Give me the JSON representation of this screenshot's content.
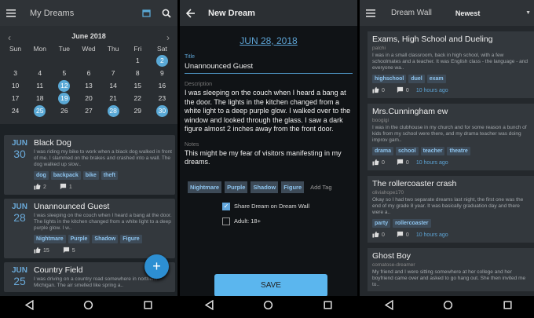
{
  "p1": {
    "title": "My Dreams",
    "month": "June 2018",
    "weekdays": [
      "Sun",
      "Mon",
      "Tue",
      "Wed",
      "Thu",
      "Fri",
      "Sat"
    ],
    "weeks": [
      [
        "",
        "",
        "",
        "",
        "",
        "1",
        "2"
      ],
      [
        "3",
        "4",
        "5",
        "6",
        "7",
        "8",
        "9"
      ],
      [
        "10",
        "11",
        "12",
        "13",
        "14",
        "15",
        "16"
      ],
      [
        "17",
        "18",
        "19",
        "20",
        "21",
        "22",
        "23"
      ],
      [
        "24",
        "25",
        "26",
        "27",
        "28",
        "29",
        "30"
      ]
    ],
    "selected": [
      "2",
      "12",
      "19",
      "25",
      "28",
      "30"
    ],
    "dreams": [
      {
        "month": "JUN",
        "day": "30",
        "title": "Black Dog",
        "body": "I was riding my bike to work when a black dog walked in front of me. I slammed on the brakes and crashed into a wall. The dog walked up slow..",
        "tags": [
          "dog",
          "backpack",
          "bike",
          "theft"
        ],
        "likes": "2",
        "comments": "1"
      },
      {
        "month": "JUN",
        "day": "28",
        "title": "Unannounced Guest",
        "body": "I was sleeping on the couch when I heard a bang at the door. The lights in the kitchen changed from a white light to a deep purple glow. I w..",
        "tags": [
          "Nightmare",
          "Purple",
          "Shadow",
          "Figure"
        ],
        "likes": "15",
        "comments": "5"
      },
      {
        "month": "JUN",
        "day": "25",
        "title": "Country Field",
        "body": "I was driving on a country road somewhere in northern Michigan. The air smelled like spring a..",
        "tags": [],
        "likes": "",
        "comments": ""
      }
    ]
  },
  "p2": {
    "title": "New Dream",
    "date": "JUN 28, 2018",
    "title_label": "Title",
    "title_value": "Unannounced Guest",
    "desc_label": "Description",
    "desc_value": "I was sleeping on the couch when I heard a bang at the door. The lights in the kitchen changed from a white light to a deep purple glow. I walked over to the window and looked through the glass. I saw a dark figure almost 2 inches away from the front door.",
    "notes_label": "Notes",
    "notes_value": "This might be my fear of visitors manifesting in my dreams.",
    "tags": [
      "Nightmare",
      "Purple",
      "Shadow",
      "Figure"
    ],
    "add_tag": "Add Tag",
    "share_label": "Share Dream on Dream Wall",
    "adult_label": "Adult: 18+",
    "save": "SAVE"
  },
  "p3": {
    "title": "Dream Wall",
    "sort": "Newest",
    "posts": [
      {
        "title": "Exams, High School and Dueling",
        "author": "palchi",
        "body": "I was in a small classroom, back in high school, with a few schoolmates and a teacher. It was English class - the language - and everyone wa..",
        "tags": [
          "highschool",
          "duel",
          "exam"
        ],
        "likes": "0",
        "comments": "0",
        "time": "10 hours ago"
      },
      {
        "title": "Mrs.Cunningham ew",
        "author": "boogigi",
        "body": "I was in the clubhouse in my church and for some reason a bunch of kids from my school were there, and my drama teacher was doing improv gam..",
        "tags": [
          "drama",
          "school",
          "teacher",
          "theatre"
        ],
        "likes": "0",
        "comments": "0",
        "time": "10 hours ago"
      },
      {
        "title": "The rollercoaster crash",
        "author": "oliviahope170",
        "body": "Okay so I had two separate dreams last night, the first one was the end of my grade 8 year. It was basically graduation day and there were a..",
        "tags": [
          "party",
          "rollercoaster"
        ],
        "likes": "0",
        "comments": "0",
        "time": "10 hours ago"
      },
      {
        "title": "Ghost Boy",
        "author": "comatose-dreamer",
        "body": "My friend and I were sitting somewhere at her college and her boyfriend came over and asked to go hang out. She then invited me to..",
        "tags": [],
        "likes": "",
        "comments": "",
        "time": ""
      }
    ]
  },
  "colors": {
    "accent": "#5aa9d6",
    "fab": "#2d8fd2",
    "save": "#5bb6ee"
  },
  "icons": [
    "menu-icon",
    "calendar-icon",
    "search-icon",
    "back-arrow-icon",
    "thumbs-up-icon",
    "comment-icon",
    "plus-icon",
    "checkbox-icon",
    "dropdown-icon",
    "nav-back-icon",
    "nav-home-icon",
    "nav-recents-icon"
  ]
}
